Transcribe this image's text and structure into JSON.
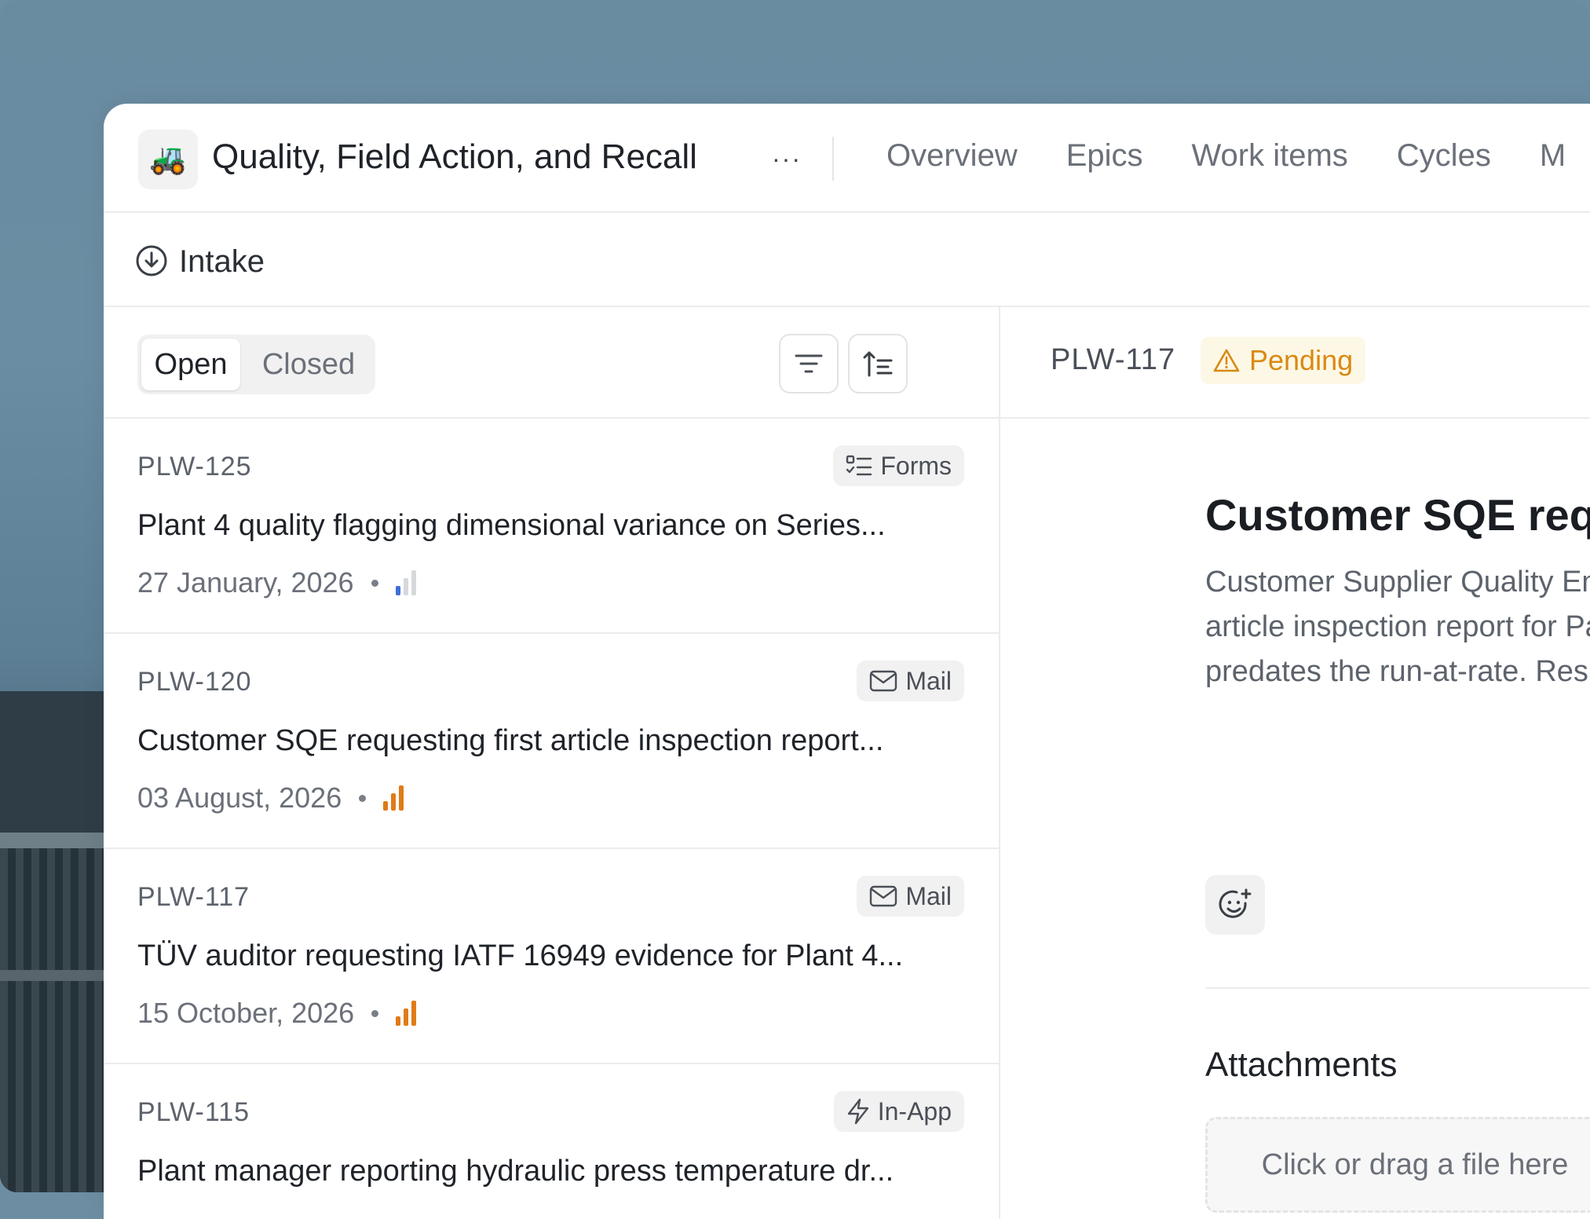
{
  "project": {
    "icon": "tractor-emoji",
    "icon_glyph": "🚜",
    "title": "Quality, Field Action, and Recall",
    "more": "···"
  },
  "nav": [
    "Overview",
    "Epics",
    "Work items",
    "Cycles",
    "M"
  ],
  "subheader": {
    "label": "Intake",
    "icon": "intake-arrow-icon"
  },
  "filters": {
    "open": "Open",
    "closed": "Closed"
  },
  "items": [
    {
      "id": "PLW-125",
      "source": "Forms",
      "source_icon": "forms-icon",
      "title": "Plant 4 quality flagging dimensional variance on Series...",
      "date": "27 January, 2026",
      "priority": "low",
      "priority_color": "#3f6fd6"
    },
    {
      "id": "PLW-120",
      "source": "Mail",
      "source_icon": "mail-icon",
      "title": "Customer SQE requesting first article inspection report...",
      "date": "03 August, 2026",
      "priority": "high",
      "priority_color": "#e07b17"
    },
    {
      "id": "PLW-117",
      "source": "Mail",
      "source_icon": "mail-icon",
      "title": "TÜV auditor requesting IATF 16949 evidence for Plant 4...",
      "date": "15 October, 2026",
      "priority": "high",
      "priority_color": "#e07b17"
    },
    {
      "id": "PLW-115",
      "source": "In-App",
      "source_icon": "lightning-icon",
      "title": "Plant manager reporting hydraulic press temperature dr..."
    }
  ],
  "detail": {
    "id": "PLW-117",
    "status": "Pending",
    "status_color": "#d98a12",
    "title": "Customer SQE requesti",
    "description_lines": [
      "Customer Supplier Quality Engine",
      "article inspection report for Part N",
      "predates the run-at-rate. Respon"
    ],
    "attachments_title": "Attachments",
    "dropzone_text": "Click or drag a file here"
  }
}
